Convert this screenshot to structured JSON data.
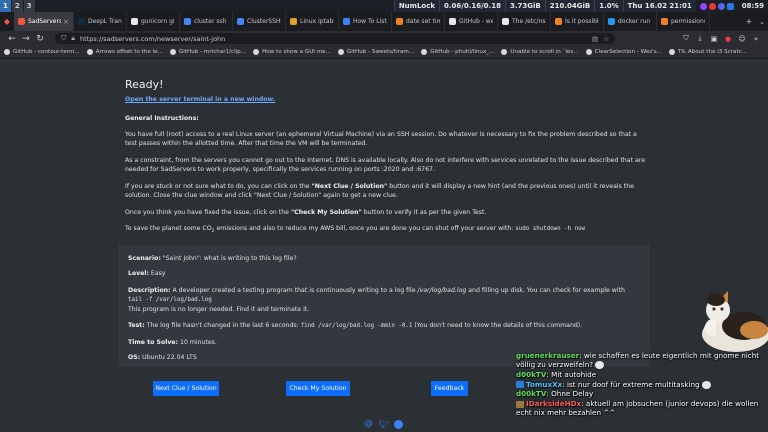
{
  "statusbar": {
    "workspaces": [
      "1",
      "2",
      "3"
    ],
    "numlock": "NumLock",
    "load": "0.06/0.16/0.18",
    "disk": "3.73GiB",
    "mem": "210.04GiB",
    "cpu": "1.0%",
    "datetime": "Thu 16.02 21:01",
    "time": "08:59"
  },
  "tabs": [
    {
      "label": "SadServers",
      "color": "#f0563c"
    },
    {
      "label": "DeepL Translate",
      "color": "#0f2b46"
    },
    {
      "label": "gunicorn github",
      "color": "#e8e8e8"
    },
    {
      "label": "cluster ssh - G",
      "color": "#4285f4"
    },
    {
      "label": "ClusterSSHscreen",
      "color": "#4285f4"
    },
    {
      "label": "Linux iptables",
      "color": "#e0a030"
    },
    {
      "label": "How To List and",
      "color": "#3b82f6"
    },
    {
      "label": "date set time",
      "color": "#f48024"
    },
    {
      "label": "GitHub - wez/",
      "color": "#e8e8e8"
    },
    {
      "label": "The /etc/nsswi",
      "color": "#e8e8e8"
    },
    {
      "label": "Is it possible t",
      "color": "#f48024"
    },
    {
      "label": "docker run | D",
      "color": "#2496ed"
    },
    {
      "label": "permissions -",
      "color": "#f48024"
    }
  ],
  "toolbar": {
    "url": "https://sadservers.com/newserver/saint-john"
  },
  "bookmarks": [
    "GitHub - contour-term...",
    "Arrows offset to the le...",
    "GitHub - mrichar1/clip...",
    "How to show a GUI me...",
    "GitHub - Sweets/tiram...",
    "GitHub - phuhl/linux_...",
    "Unable to scroll in `les...",
    "ClearSelection - Wez's...",
    "TIL About the i3 Scratc..."
  ],
  "page": {
    "title": "Ready!",
    "terminal_link": "Open the server terminal in a new window.",
    "general_heading": "General Instructions:",
    "p1": "You have full (root) access to a real Linux server (an ephemeral Virtual Machine) via an SSH session. Do whatever is necessary to fix the problem described so that a test passes within the allotted time. After that time the VM will be terminated.",
    "p2": "As a constraint, from the servers you cannot go out to the Internet. DNS is available locally. Also do not interfere with services unrelated to the issue described that are needed for SadServers to work properly, specifically the services running on ports :2020 and :6767.",
    "p3_pre": "If you are stuck or not sure what to do, you can click on the ",
    "p3_b1": "\"Next Clue / Solution\"",
    "p3_mid": " button and it will display a new hint (and the previous ones) until it reveals the solution. Close the clue window and click \"Next Clue / Solution\" again to get a new clue.",
    "p4_pre": "Once you think you have fixed the issue, click on the ",
    "p4_b": "\"Check My Solution\"",
    "p4_post": " button to verify it as per the given Test.",
    "p5_pre": "To save the planet some CO",
    "p5_sub": "2",
    "p5_post": " emissions and also to reduce my AWS bill, once you are done you can shut off your server with: ",
    "p5_code": "sudo shutdown -h now",
    "scenario_label": "Scenario:",
    "scenario_text": " \"Saint John\": what is writing to this log file?",
    "level_label": "Level:",
    "level_text": " Easy",
    "description_label": "Description:",
    "description_text1": " A developer created a testing program that is continuously writing to a log file ",
    "description_path": "/var/log/bad.log",
    "description_text2": " and filling up disk. You can check for example with ",
    "description_code": "tail -f /var/log/bad.log",
    "description_text3": "This program is no longer needed. Find it and terminate it.",
    "test_label": "Test:",
    "test_text1": " The log file hasn't changed in the last 6 seconds: ",
    "test_code": "find /var/log/bad.log -mmin -0.1",
    "test_text2": " (You don't need to know the details of this command).",
    "time_label": "Time to Solve:",
    "time_text": " 10 minutes.",
    "os_label": "OS:",
    "os_text": " Ubuntu 22.04 LTS",
    "btn_clue": "Next Clue / Solution",
    "btn_check": "Check My Solution",
    "btn_feedback": "Feedback"
  },
  "chat": [
    {
      "user": "gruenerkrauser",
      "color": "#5fe05f",
      "msg": " wie schaffen es leute eigentlich mit gnome nicht völlig zu verzweifeln?"
    },
    {
      "user": "d00kTV",
      "color": "#5fe05f",
      "msg": " Mit autohide"
    },
    {
      "user": "TomuxXx",
      "color": "#4fc3f7",
      "msg": " ist nur doof für extreme multitasking"
    },
    {
      "user": "d00kTV",
      "color": "#5fe05f",
      "msg": " Ohne Delay"
    },
    {
      "user": "IDarksideHDx",
      "color": "#ff5a5a",
      "msg": " aktuell am jobsuchen (junior devops) die wollen echt nix mehr bezahlen ^^"
    }
  ]
}
